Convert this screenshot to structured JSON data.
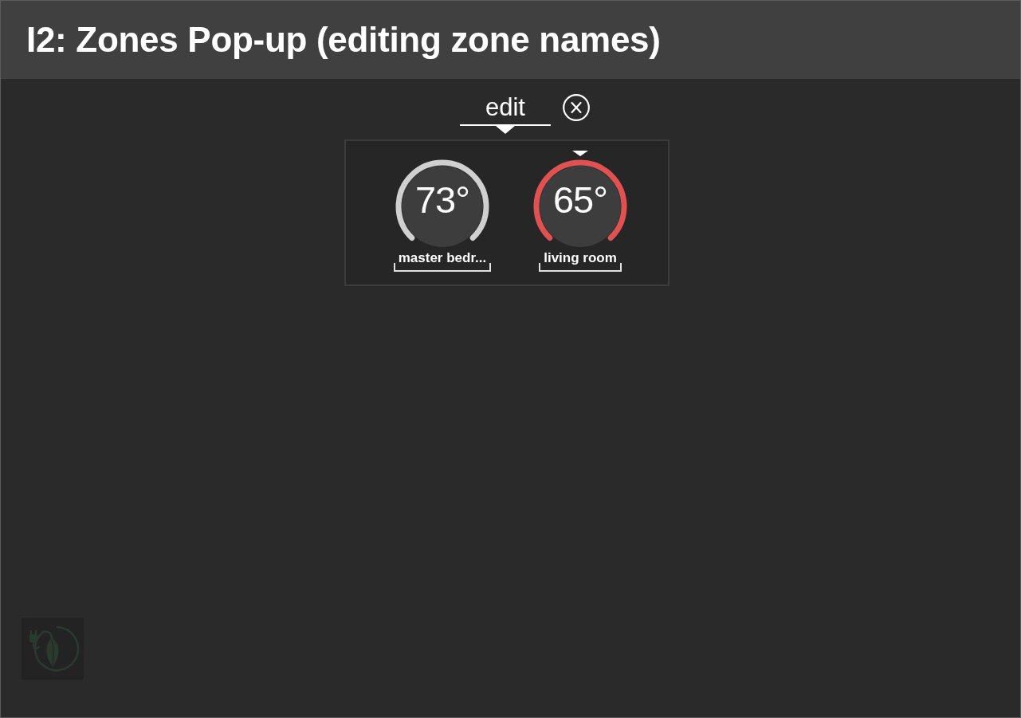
{
  "header": {
    "title": "I2: Zones Pop-up (editing zone names)"
  },
  "edit_button": {
    "label": "edit"
  },
  "zones": [
    {
      "temperature": "73°",
      "name": "master bedr...",
      "selected": false
    },
    {
      "temperature": "65°",
      "name": "living room",
      "selected": true
    }
  ]
}
